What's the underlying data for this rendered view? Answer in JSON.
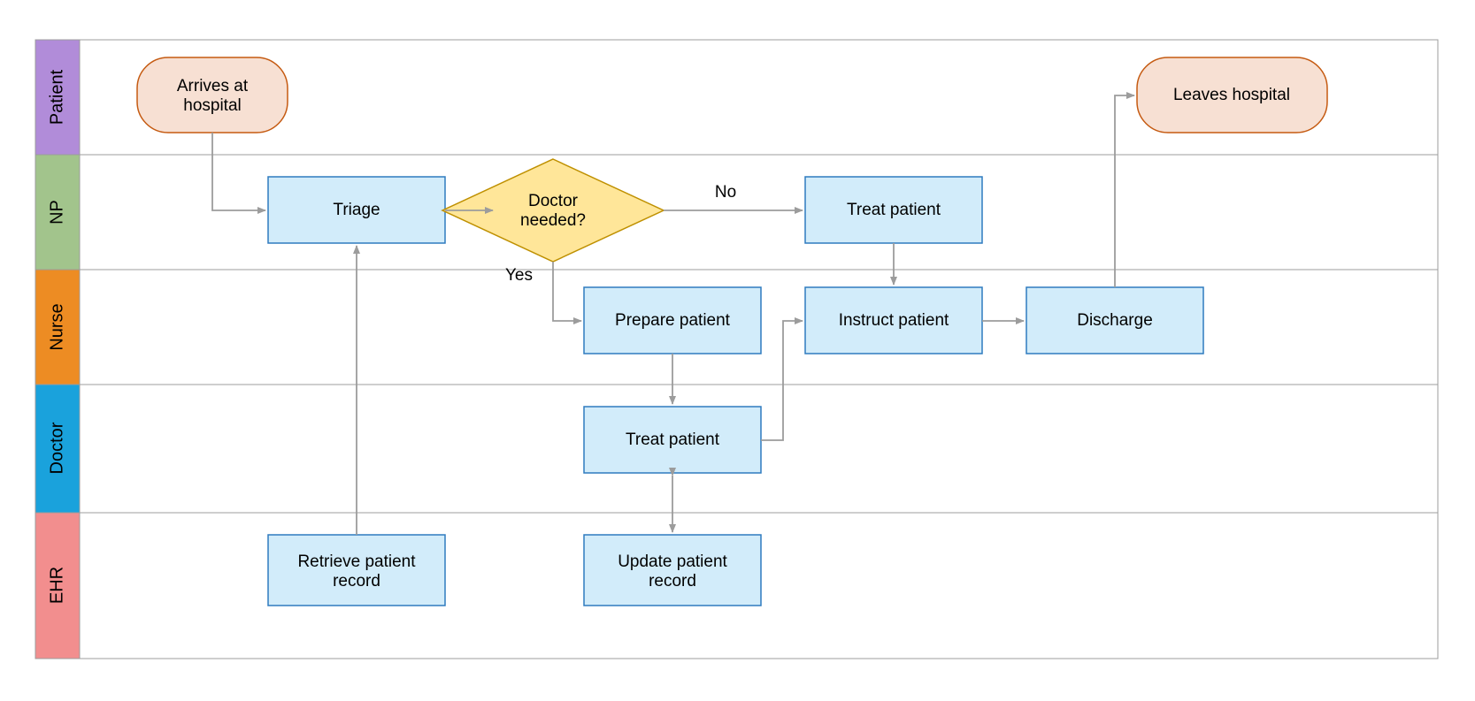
{
  "lanes": {
    "patient": "Patient",
    "np": "NP",
    "nurse": "Nurse",
    "doctor": "Doctor",
    "ehr": "EHR"
  },
  "nodes": {
    "arrives_l1": "Arrives at",
    "arrives_l2": "hospital",
    "leaves": "Leaves hospital",
    "triage": "Triage",
    "doctor_needed_l1": "Doctor",
    "doctor_needed_l2": "needed?",
    "treat_np": "Treat patient",
    "prepare": "Prepare patient",
    "instruct": "Instruct patient",
    "discharge": "Discharge",
    "treat_doc": "Treat patient",
    "retrieve_l1": "Retrieve patient",
    "retrieve_l2": "record",
    "update_l1": "Update patient",
    "update_l2": "record"
  },
  "edges": {
    "no": "No",
    "yes": "Yes"
  }
}
